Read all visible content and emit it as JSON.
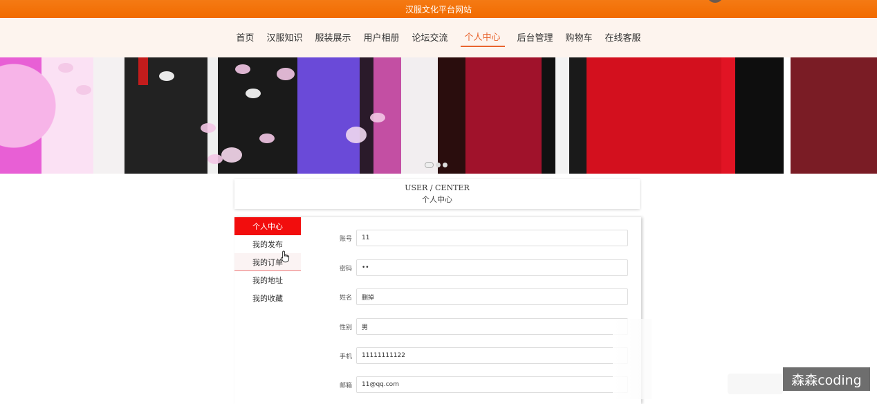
{
  "site": {
    "title": "汉服文化平台网站"
  },
  "nav": {
    "items": [
      {
        "label": "首页"
      },
      {
        "label": "汉服知识"
      },
      {
        "label": "服装展示"
      },
      {
        "label": "用户相册"
      },
      {
        "label": "论坛交流"
      },
      {
        "label": "个人中心",
        "active": true
      },
      {
        "label": "后台管理"
      },
      {
        "label": "购物车"
      },
      {
        "label": "在线客服"
      }
    ]
  },
  "banner": {
    "slide_count": 3,
    "active_slide": 1
  },
  "section": {
    "title_en": "USER / CENTER",
    "title_zh": "个人中心"
  },
  "sidebar": {
    "items": [
      {
        "label": "个人中心",
        "active": true
      },
      {
        "label": "我的发布"
      },
      {
        "label": "我的订单"
      },
      {
        "label": "我的地址"
      },
      {
        "label": "我的收藏"
      }
    ]
  },
  "form": {
    "account": {
      "label": "账号",
      "value": "11"
    },
    "password": {
      "label": "密码",
      "value": "••"
    },
    "name": {
      "label": "姓名",
      "value": "删掉"
    },
    "gender": {
      "label": "性别",
      "value": "男"
    },
    "phone": {
      "label": "手机",
      "value": "11111111122"
    },
    "email": {
      "label": "邮箱",
      "value": "11@qq.com"
    }
  },
  "watermark": {
    "text": "森森coding"
  },
  "colors": {
    "header": "#f26b00",
    "nav_active": "#e8642e",
    "sidebar_active": "#f20d0d"
  }
}
